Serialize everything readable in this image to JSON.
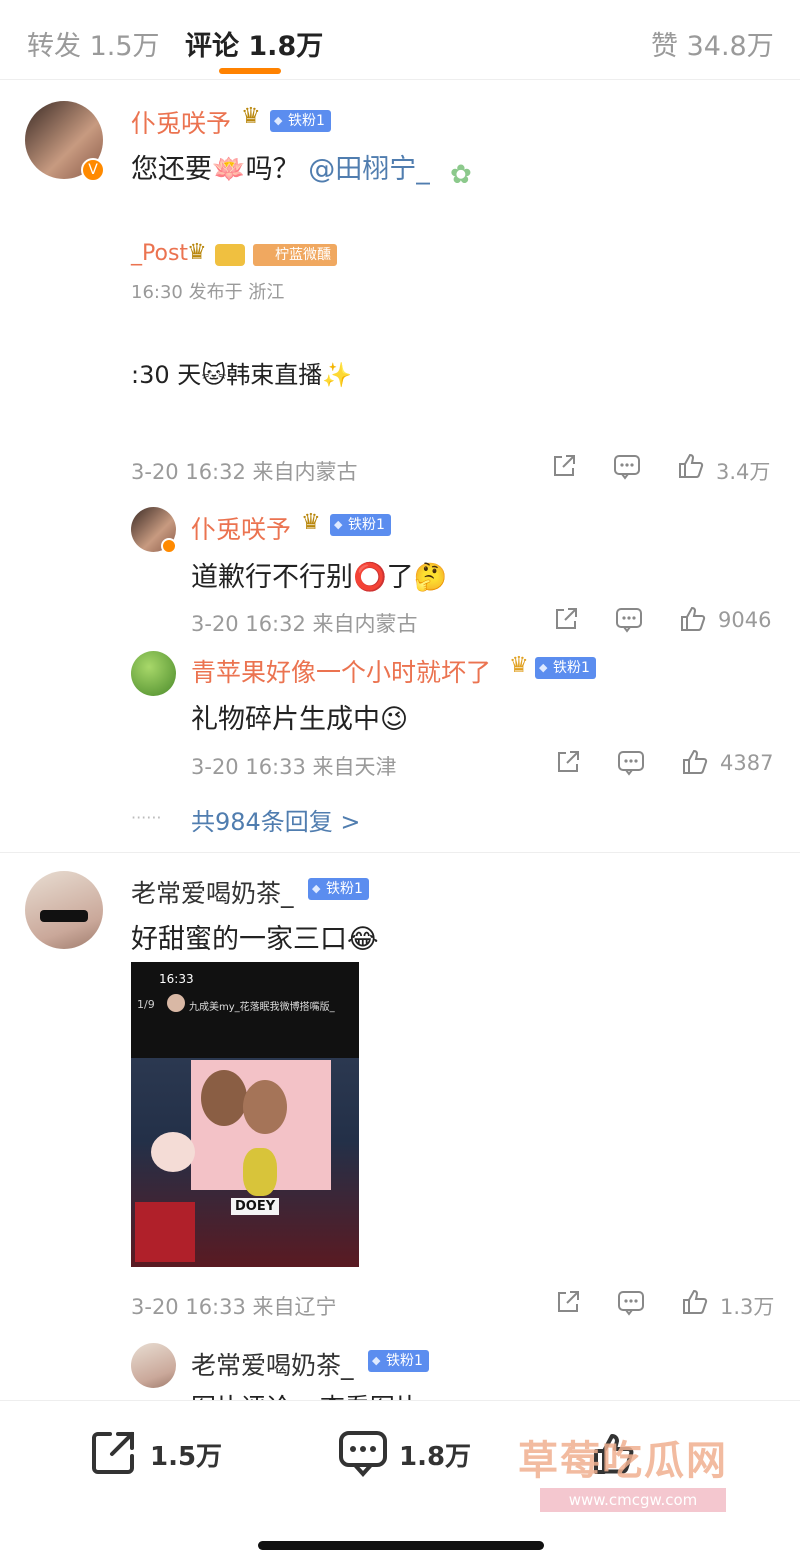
{
  "header": {
    "tabs": [
      {
        "label": "转发 1.5万"
      },
      {
        "label": "评论 1.8万"
      },
      {
        "label": "赞 34.8万"
      }
    ]
  },
  "comment1": {
    "username": "仆兎咲予",
    "badge": "铁粉1",
    "text_main": "您还要🪷吗？",
    "text_mention": "@田栩宁_",
    "quoted_name": "_Post",
    "quoted_badge": "柠蓝微醺",
    "quoted_time": "16:30  发布于 浙江",
    "quoted_text": ":30 天🐱韩束直播✨",
    "meta": "3-20 16:32 来自内蒙古",
    "likes": "3.4万"
  },
  "reply1": {
    "username": "仆兎咲予",
    "badge": "铁粉1",
    "text": "道歉行不行别⭕了🤔",
    "meta": "3-20 16:32 来自内蒙古",
    "likes": "9046"
  },
  "reply2": {
    "username": "青苹果好像一个小时就坏了",
    "badge": "铁粉1",
    "text": "礼物碎片生成中😉",
    "meta": "3-20 16:33 来自天津",
    "likes": "4387"
  },
  "more_replies": "共984条回复 >",
  "more_dots": "······",
  "comment2": {
    "username": "老常爱喝奶茶_",
    "badge": "铁粉1",
    "text": "好甜蜜的一家三口😂",
    "photo_time": "16:33",
    "photo_page": "1/9",
    "photo_title": "九成美my_花落眠我微博搭嘴版_",
    "photo_sign": "DOEY",
    "meta": "3-20 16:33 来自辽宁",
    "likes": "1.3万"
  },
  "reply3": {
    "username": "老常爱喝奶茶_",
    "badge": "铁粉1",
    "text": "图片评论 ⊡查看图片"
  },
  "bottom": {
    "repost_count": "1.5万",
    "comment_count": "1.8万"
  },
  "watermark": {
    "text": "草莓吃瓜网",
    "url": "www.cmcgw.com"
  }
}
